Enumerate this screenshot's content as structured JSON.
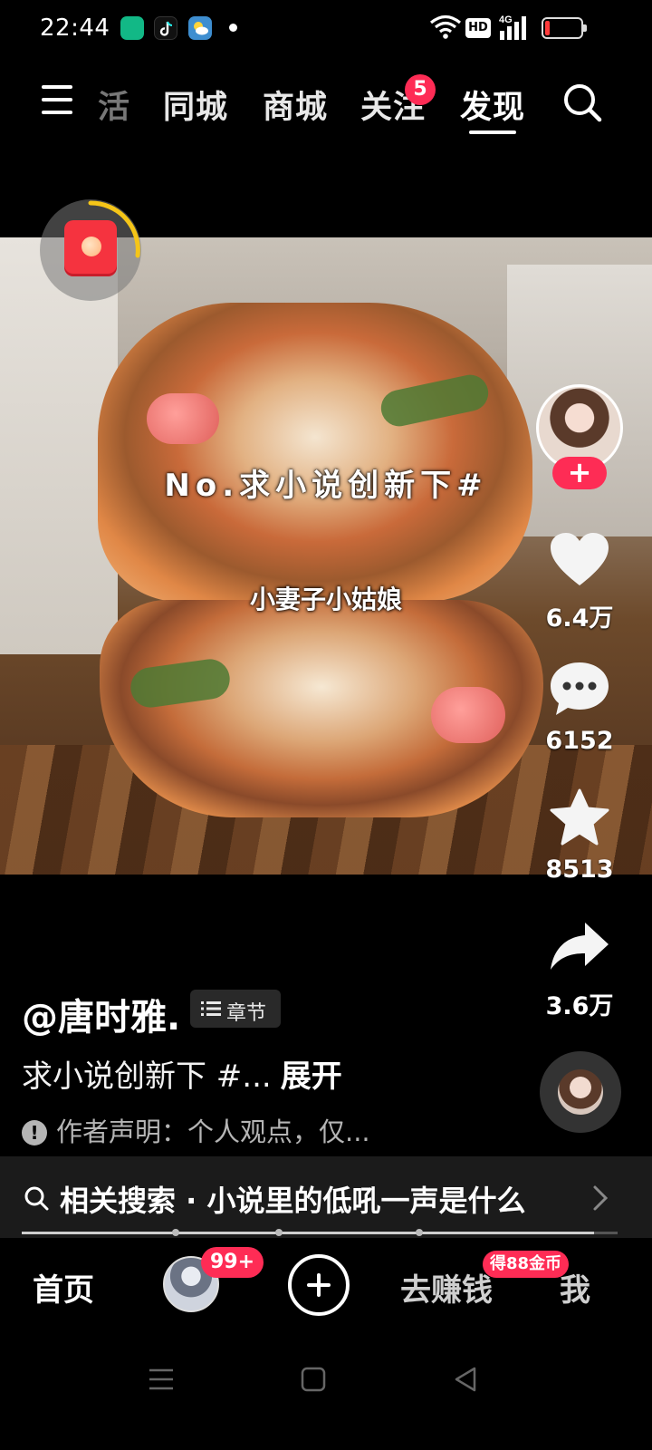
{
  "status_bar": {
    "time": "22:44",
    "hd_label": "HD",
    "network_label": "4G"
  },
  "top_nav": {
    "tabs": [
      {
        "label": "活",
        "active": false
      },
      {
        "label": "同城",
        "active": false
      },
      {
        "label": "商城",
        "active": false
      },
      {
        "label": "关注",
        "active": false,
        "badge": "5"
      },
      {
        "label": "发现",
        "active": true
      }
    ]
  },
  "video": {
    "overlay_title": "No.求小说创新下#",
    "overlay_subtitle": "小妻子小姑娘"
  },
  "actions": {
    "follow_label": "+",
    "likes": "6.4万",
    "comments": "6152",
    "favorites": "8513",
    "shares": "3.6万"
  },
  "caption": {
    "author": "@唐时雅.",
    "chapter_label": "章节",
    "text": "求小说创新下 #...",
    "expand_label": "展开",
    "disclaimer_icon": "!",
    "disclaimer": "作者声明：个人观点，仅..."
  },
  "related_search": {
    "label": "相关搜索 · 小说里的低吼一声是什么"
  },
  "bottom_tabs": {
    "home": "首页",
    "messages_badge": "99+",
    "earn": "去赚钱",
    "earn_badge": "得88金币",
    "me": "我"
  },
  "playback_progress": 0.96,
  "colors": {
    "accent": "#fe2c55",
    "timer_ring": "#f5c518"
  }
}
